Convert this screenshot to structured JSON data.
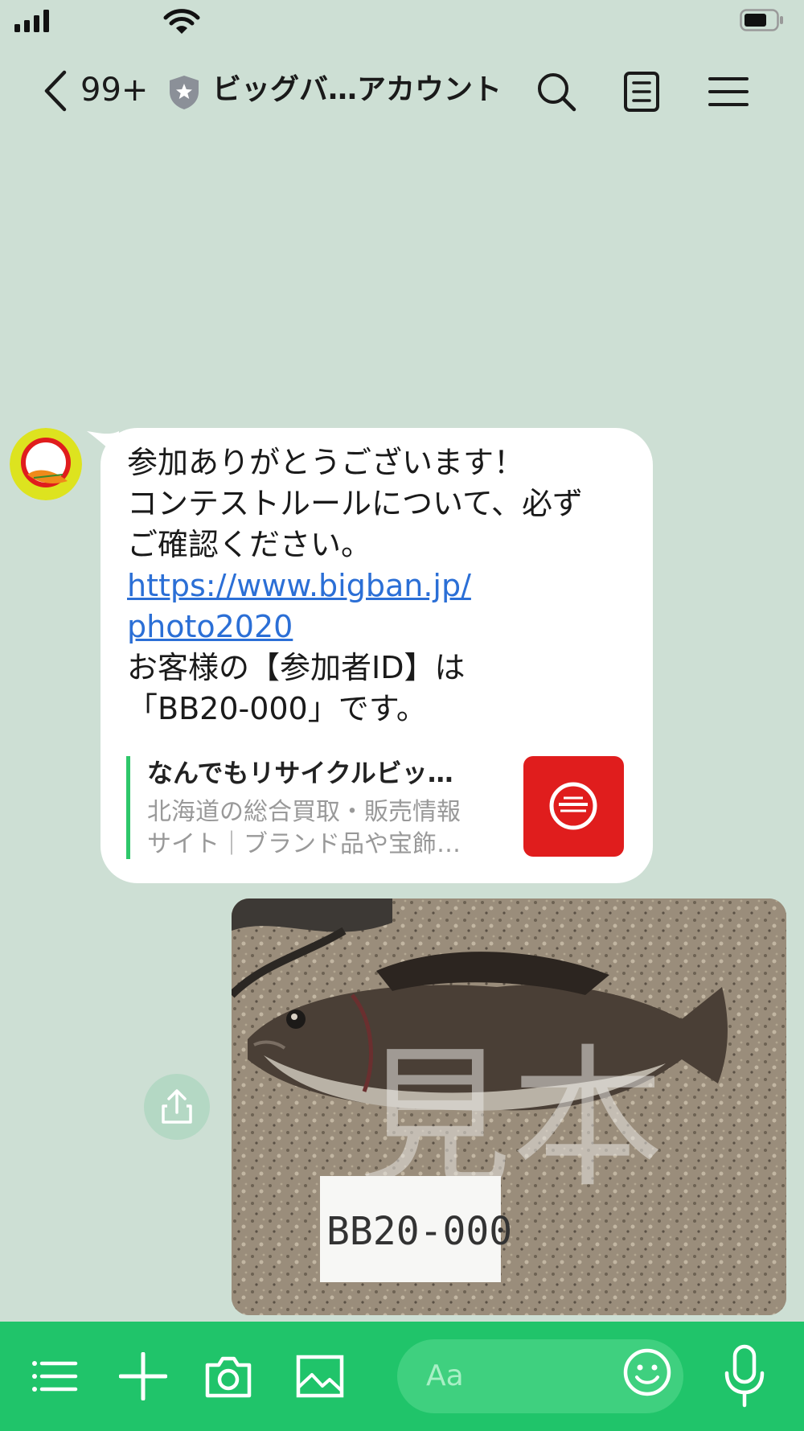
{
  "status_bar": {
    "icons": [
      "signal-icon",
      "wifi-icon",
      "battery-icon"
    ]
  },
  "header": {
    "back_count": "99+",
    "title": "ビッグバ…アカウント",
    "icons": [
      "back-icon",
      "verified-badge-icon",
      "search-icon",
      "notes-icon",
      "menu-icon"
    ]
  },
  "message": {
    "lines": [
      "参加ありがとうございます！",
      "コンテストルールについて、必ず",
      "ご確認ください。"
    ],
    "link_lines": [
      "https://www.bigban.jp/",
      "photo2020"
    ],
    "id_lines": [
      "お客様の【参加者ID】は",
      "「BB20-000」です。"
    ],
    "preview": {
      "title": "なんでもリサイクルビッ…",
      "desc_lines": [
        "北海道の総合買取・販売情報",
        "サイト｜ブランド品や宝飾…"
      ]
    }
  },
  "photo": {
    "watermark": "見本",
    "card_text": "BB20-000"
  },
  "input_bar": {
    "placeholder": "Aa",
    "icons": [
      "list-icon",
      "plus-icon",
      "camera-icon",
      "image-icon",
      "emoji-icon",
      "mic-icon"
    ]
  },
  "colors": {
    "background": "#cddfd4",
    "accent_green": "#20c46a",
    "link": "#2b6fd6",
    "brand_red": "#e01d1d"
  }
}
